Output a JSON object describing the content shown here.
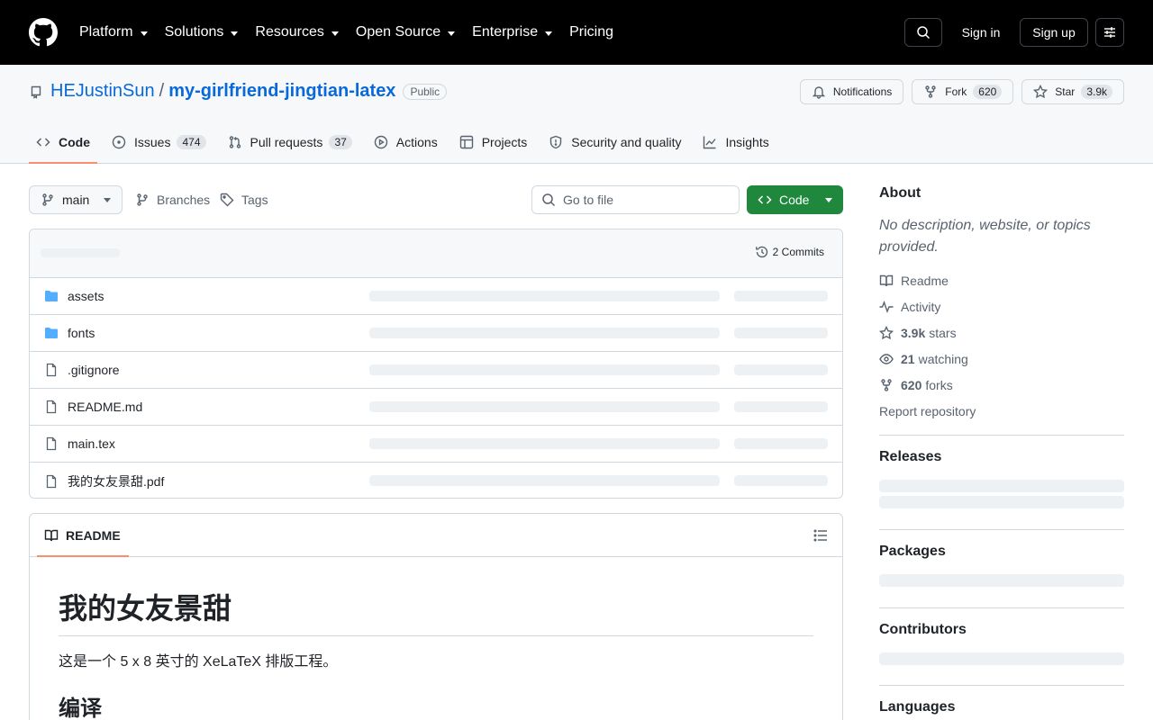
{
  "nav": {
    "items": [
      {
        "label": "Platform",
        "caret": true
      },
      {
        "label": "Solutions",
        "caret": true
      },
      {
        "label": "Resources",
        "caret": true
      },
      {
        "label": "Open Source",
        "caret": true
      },
      {
        "label": "Enterprise",
        "caret": true
      },
      {
        "label": "Pricing",
        "caret": false
      }
    ],
    "sign_in": "Sign in",
    "sign_up": "Sign up"
  },
  "repo": {
    "owner": "HEJustinSun",
    "separator": "/",
    "name": "my-girlfriend-jingtian-latex",
    "visibility": "Public",
    "notifications_label": "Notifications",
    "fork_label": "Fork",
    "fork_count": "620",
    "star_label": "Star",
    "star_count": "3.9k"
  },
  "tabs": [
    {
      "label": "Code",
      "icon": "code-icon",
      "active": true
    },
    {
      "label": "Issues",
      "count": "474",
      "icon": "issue-icon"
    },
    {
      "label": "Pull requests",
      "count": "37",
      "icon": "pull-request-icon"
    },
    {
      "label": "Actions",
      "icon": "play-icon"
    },
    {
      "label": "Projects",
      "icon": "table-icon"
    },
    {
      "label": "Security and quality",
      "icon": "shield-icon"
    },
    {
      "label": "Insights",
      "icon": "graph-icon"
    }
  ],
  "toolbar": {
    "branch": "main",
    "branches_label": "Branches",
    "tags_label": "Tags",
    "goto_placeholder": "Go to file",
    "code_button": "Code"
  },
  "files": {
    "commits_label": "2 Commits",
    "rows": [
      {
        "name": "assets",
        "type": "folder"
      },
      {
        "name": "fonts",
        "type": "folder"
      },
      {
        "name": ".gitignore",
        "type": "file"
      },
      {
        "name": "README.md",
        "type": "file"
      },
      {
        "name": "main.tex",
        "type": "file"
      },
      {
        "name": "我的女友景甜.pdf",
        "type": "file"
      }
    ]
  },
  "readme": {
    "tab_label": "README",
    "h1": "我的女友景甜",
    "p": "这是一个 5 x 8 英寸的 XeLaTeX 排版工程。",
    "h2": "编译"
  },
  "sidebar": {
    "about_title": "About",
    "description": "No description, website, or topics provided.",
    "readme": "Readme",
    "activity": "Activity",
    "stars_count": "3.9k",
    "stars_label": "stars",
    "watching_count": "21",
    "watching_label": "watching",
    "forks_count": "620",
    "forks_label": "forks",
    "report": "Report repository",
    "releases": "Releases",
    "packages": "Packages",
    "contributors": "Contributors",
    "languages": "Languages"
  },
  "colors": {
    "accent_link": "#0969da",
    "primary_button": "#1f883d",
    "active_tab_underline": "#fd8c73",
    "folder_icon": "#54aeff"
  }
}
